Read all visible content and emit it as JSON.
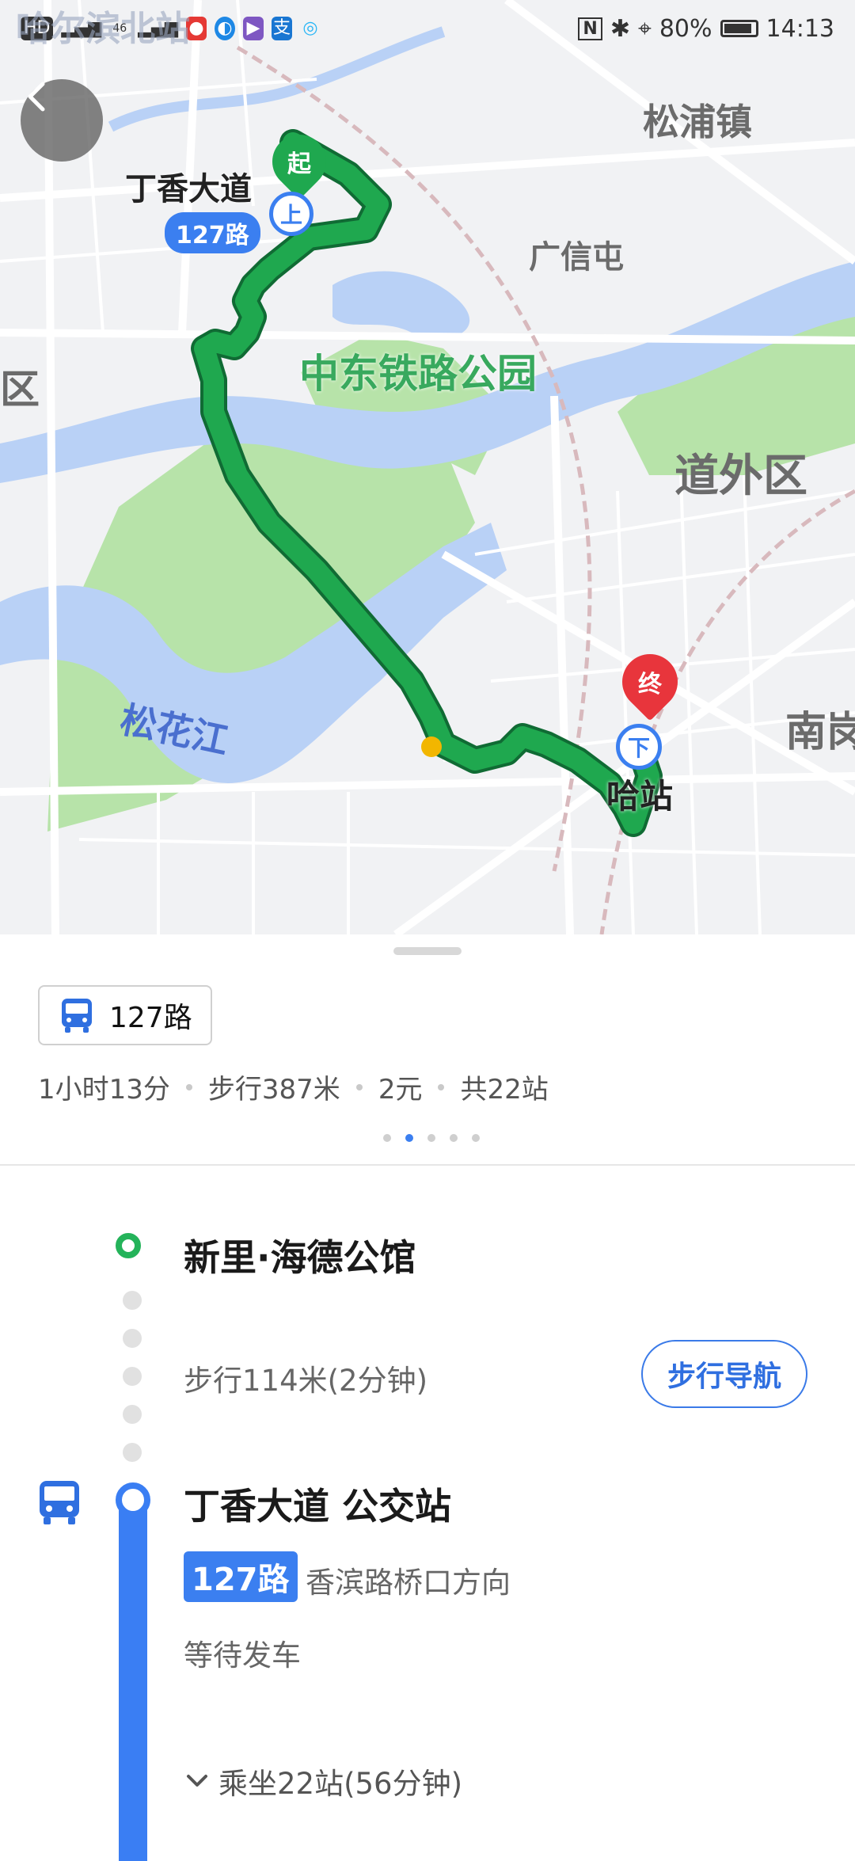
{
  "status_bar": {
    "carrier_text": "哈尔滨北站",
    "net_badges": [
      "HD",
      "46",
      "46"
    ],
    "nfc": "N",
    "battery": "80%",
    "time": "14:13"
  },
  "map": {
    "labels": {
      "start_stop": "丁香大道",
      "line_tag": "127路",
      "songpu": "松浦镇",
      "guangxin": "广信屯",
      "park": "中东铁路公园",
      "daowai": "道外区",
      "river": "松花江",
      "nan": "南岗",
      "end_stop": "哈站",
      "qu": "区",
      "top_left": "哈尔滨北站"
    },
    "pins": {
      "start": "起",
      "board": "上",
      "end": "终",
      "alight": "下"
    },
    "colors": {
      "route": "#1fa84f",
      "river": "#b9d1f6",
      "park": "#b7e3a9",
      "start_pin": "#1fa84f",
      "end_pin": "#e8353c",
      "accent": "#3b7ff0"
    }
  },
  "route_card": {
    "chip_label": "127路",
    "summary": {
      "duration": "1小时13分",
      "walk": "步行387米",
      "fare": "2元",
      "stops": "共22站"
    },
    "pager": {
      "count": 5,
      "active_index": 1
    }
  },
  "steps": {
    "origin_name": "新里·海德公馆",
    "walk_info": "步行114米(2分钟)",
    "walk_nav_label": "步行导航",
    "bus_stop_name": "丁香大道 公交站",
    "line_badge": "127路",
    "direction": "香滨路桥口方向",
    "wait_status": "等待发车",
    "ride_info": "乘坐22站(56分钟)"
  }
}
